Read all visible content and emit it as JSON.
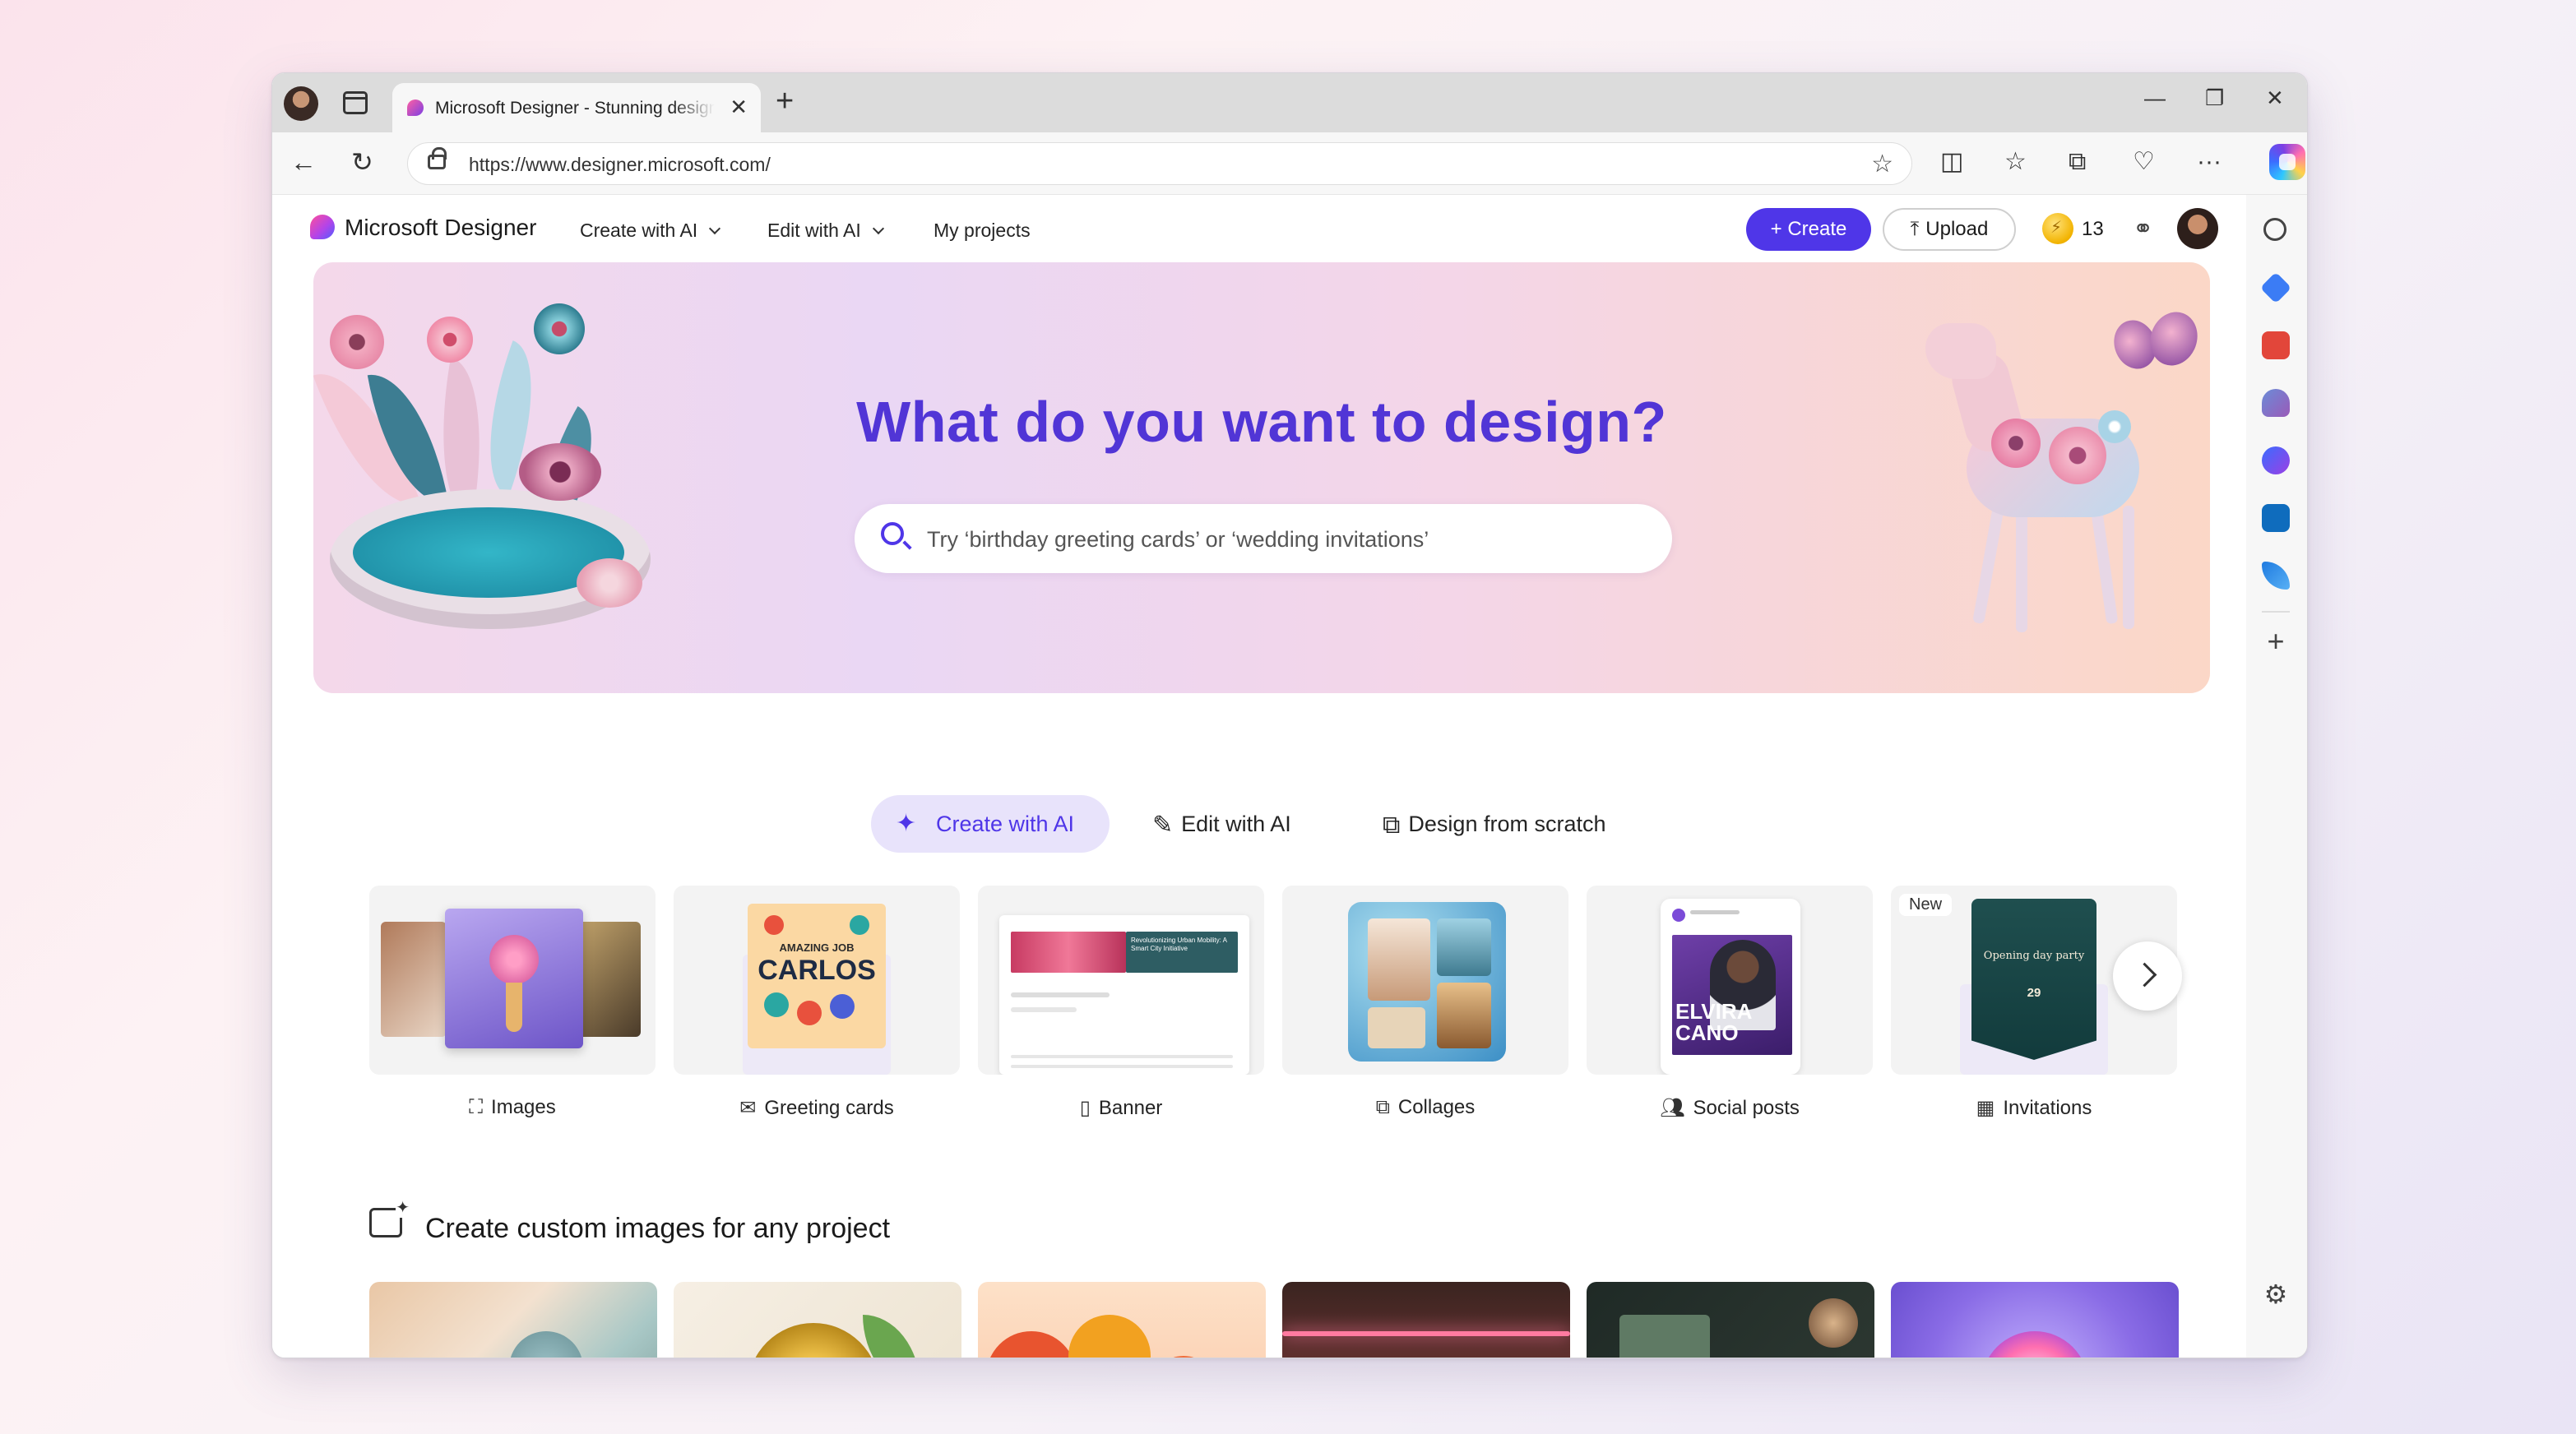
{
  "browser": {
    "tab_title": "Microsoft Designer - Stunning designs in a flash",
    "url": "https://www.designer.microsoft.com/",
    "icons": [
      "profile-avatar",
      "tab-actions-icon",
      "new-tab-icon",
      "back-icon",
      "refresh-icon",
      "lock-icon",
      "favorite-star-icon",
      "split-screen-icon",
      "favorites-icon",
      "collections-icon",
      "browser-essentials-icon",
      "more-icon",
      "copilot-icon"
    ]
  },
  "header": {
    "brand": "Microsoft Designer",
    "nav": [
      {
        "label": "Create with AI",
        "has_dropdown": true
      },
      {
        "label": "Edit with AI",
        "has_dropdown": true
      },
      {
        "label": "My projects",
        "has_dropdown": false
      }
    ],
    "create_label": "+ Create",
    "upload_label": "Upload",
    "credits": "13"
  },
  "hero": {
    "title": "What do you want to design?",
    "search_placeholder": "Try ‘birthday greeting cards’ or ‘wedding invitations’"
  },
  "modes": [
    {
      "label": "Create with AI",
      "active": true
    },
    {
      "label": "Edit with AI",
      "active": false
    },
    {
      "label": "Design from scratch",
      "active": false
    }
  ],
  "categories": [
    {
      "label": "Images",
      "icon": "image-sparkle-icon"
    },
    {
      "label": "Greeting cards",
      "icon": "envelope-icon"
    },
    {
      "label": "Banner",
      "icon": "banner-icon"
    },
    {
      "label": "Collages",
      "icon": "collage-icon"
    },
    {
      "label": "Social posts",
      "icon": "people-icon"
    },
    {
      "label": "Invitations",
      "icon": "calendar-icon",
      "badge": "New"
    }
  ],
  "card_text": {
    "greeting_line1": "AMAZING JOB",
    "greeting_line2": "CARLOS",
    "banner_text": "Revolutionizing Urban Mobility: A Smart City Initiative",
    "social_name1": "ELVIRA",
    "social_name2": "CANO",
    "invite_title": "Opening day party",
    "invite_date": "29"
  },
  "section": {
    "title": "Create custom images for any project"
  },
  "colors": {
    "accent": "#4f36e8",
    "hero_title": "#5135d6",
    "active_mode_bg": "#e8e3fb"
  }
}
